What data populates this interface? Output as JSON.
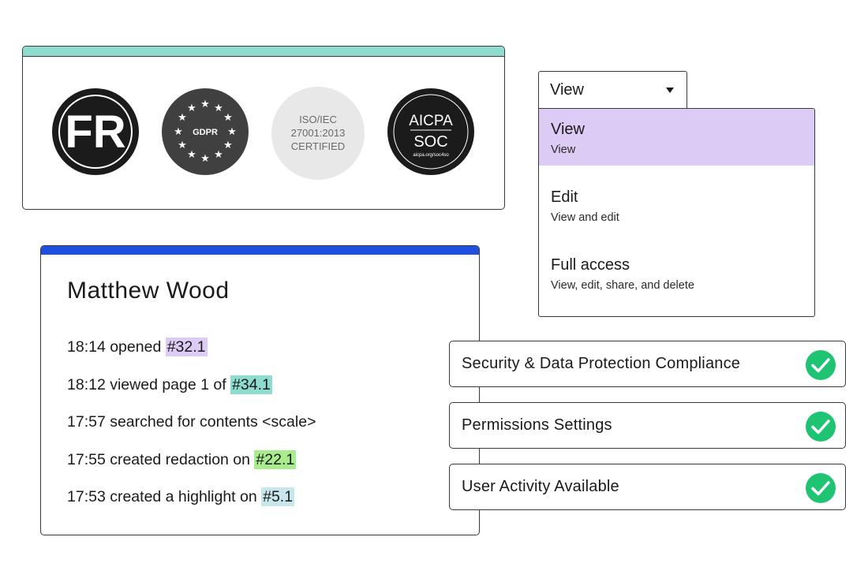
{
  "badges": {
    "accent_color": "#8ddccf",
    "items": [
      {
        "name": "fr-badge",
        "text": "FR"
      },
      {
        "name": "gdpr-badge",
        "text": "GDPR"
      },
      {
        "name": "iso-badge",
        "lines": [
          "ISO/IEC",
          "27001:2013",
          "CERTIFIED"
        ]
      },
      {
        "name": "aicpa-soc-badge",
        "lines": [
          "AICPA",
          "SOC",
          "aicpa.org/soc4so"
        ]
      }
    ]
  },
  "activity": {
    "accent_color": "#1f4fdf",
    "name": "Matthew Wood",
    "items": [
      {
        "text": "18:14 opened ",
        "tag": "#32.1",
        "tag_color": "#dccbf4"
      },
      {
        "text": "18:12 viewed page 1 of ",
        "tag": "#34.1",
        "tag_color": "#8ddccf"
      },
      {
        "text": "17:57 searched for contents <scale>",
        "tag": "",
        "tag_color": ""
      },
      {
        "text": "17:55 created redaction on ",
        "tag": "#22.1",
        "tag_color": "#a8ec8e"
      },
      {
        "text": "17:53 created a highlight on ",
        "tag": "#5.1",
        "tag_color": "#c8e6ec"
      }
    ]
  },
  "dropdown": {
    "value": "View",
    "options": [
      {
        "title": "View",
        "desc": "View",
        "selected": true
      },
      {
        "title": "Edit",
        "desc": "View and edit",
        "selected": false
      },
      {
        "title": "Full access",
        "desc": "View, edit, share, and delete",
        "selected": false
      }
    ]
  },
  "checklist": {
    "check_color": "#1fc473",
    "items": [
      {
        "label": "Security & Data Protection Compliance",
        "checked": true
      },
      {
        "label": "Permissions Settings",
        "checked": true
      },
      {
        "label": "User Activity Available",
        "checked": true
      }
    ]
  }
}
